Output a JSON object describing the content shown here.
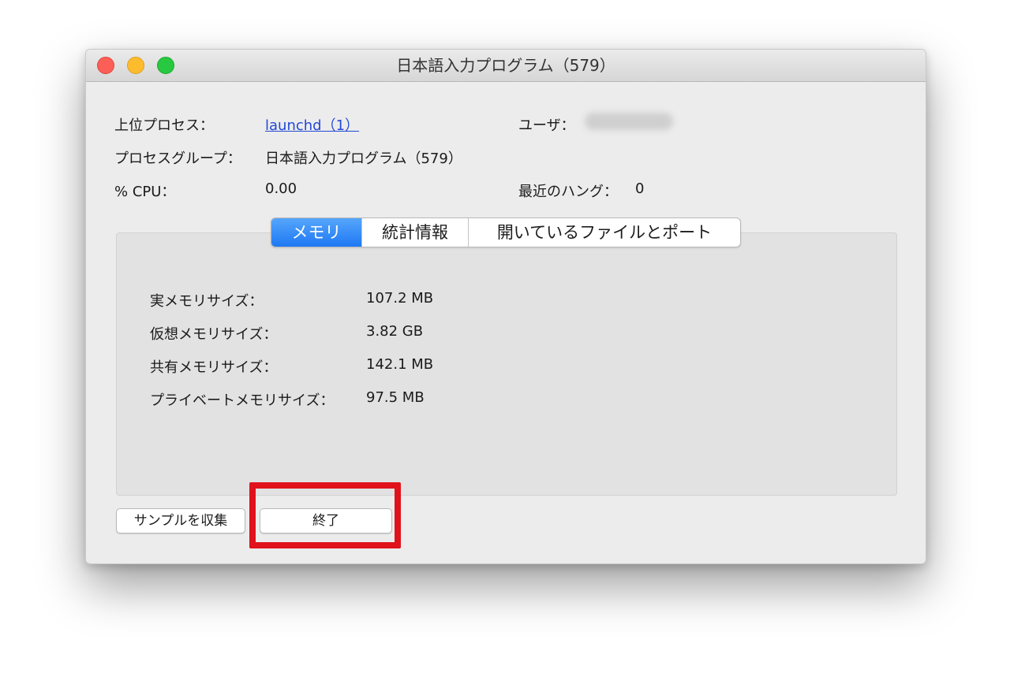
{
  "window": {
    "title": "日本語入力プログラム（579）"
  },
  "info": {
    "parent_process_label": "上位プロセス：",
    "parent_process_value": "launchd（1）",
    "user_label": "ユーザ：",
    "process_group_label": "プロセスグループ：",
    "process_group_value": "日本語入力プログラム（579）",
    "cpu_label": "% CPU：",
    "cpu_value": "0.00",
    "recent_hangs_label": "最近のハング：",
    "recent_hangs_value": "0"
  },
  "tabs": [
    {
      "label": "メモリ",
      "active": true
    },
    {
      "label": "統計情報",
      "active": false
    },
    {
      "label": "開いているファイルとポート",
      "active": false
    }
  ],
  "memory": {
    "rows": [
      {
        "label": "実メモリサイズ：",
        "value": "107.2 MB"
      },
      {
        "label": "仮想メモリサイズ：",
        "value": "3.82 GB"
      },
      {
        "label": "共有メモリサイズ：",
        "value": "142.1 MB"
      },
      {
        "label": "プライベートメモリサイズ：",
        "value": "97.5 MB"
      }
    ]
  },
  "buttons": {
    "sample_label": "サンプルを収集",
    "quit_label": "終了"
  },
  "colors": {
    "accent": "#1f78f3",
    "link": "#2349d6",
    "highlight": "#e0121b"
  }
}
